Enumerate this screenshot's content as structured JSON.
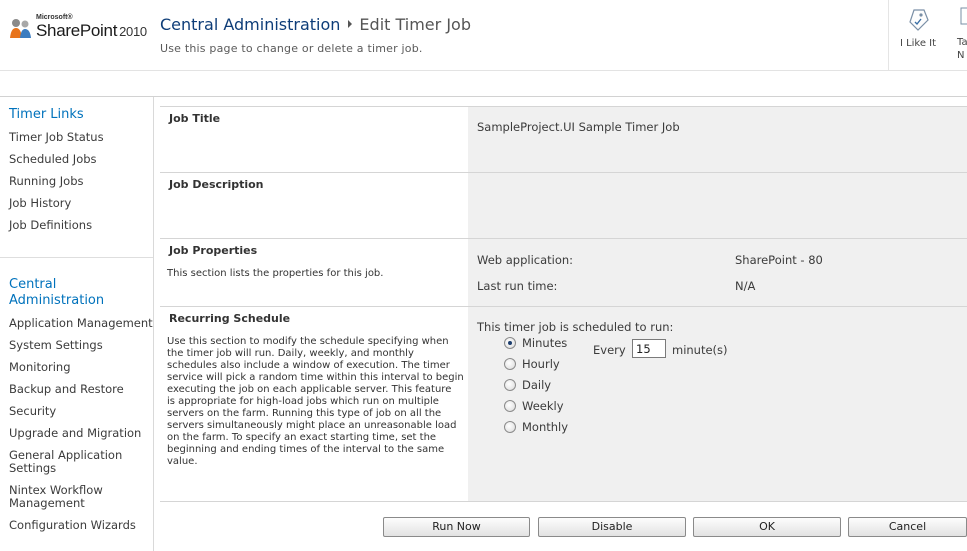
{
  "brand": {
    "microsoft": "Microsoft®",
    "product": "SharePoint",
    "year": "2010"
  },
  "header": {
    "site": "Central Administration",
    "page": "Edit Timer Job",
    "subtitle": "Use this page to change or delete a timer job."
  },
  "social": {
    "like_label": "I Like It",
    "tags_label_line1": "Ta",
    "tags_label_line2": "N"
  },
  "nav": {
    "timer_heading": "Timer Links",
    "timer_items": [
      "Timer Job Status",
      "Scheduled Jobs",
      "Running Jobs",
      "Job History",
      "Job Definitions"
    ],
    "ca_heading_line1": "Central",
    "ca_heading_line2": "Administration",
    "ca_items": [
      "Application Management",
      "System Settings",
      "Monitoring",
      "Backup and Restore",
      "Security",
      "Upgrade and Migration"
    ],
    "general_line1": "General Application",
    "general_line2": "Settings",
    "nintex_line1": "Nintex Workflow",
    "nintex_line2": "Management",
    "config": "Configuration Wizards"
  },
  "form": {
    "job_title": {
      "label": "Job Title",
      "value": "SampleProject.UI Sample Timer Job"
    },
    "job_description": {
      "label": "Job Description"
    },
    "job_properties": {
      "label": "Job Properties",
      "desc": "This section lists the properties for this job.",
      "web_app_label": "Web application:",
      "web_app_value": "SharePoint - 80",
      "last_run_label": "Last run time:",
      "last_run_value": "N/A"
    },
    "recurring": {
      "label": "Recurring Schedule",
      "desc_lines": [
        "Use this section to modify the schedule specifying when",
        "the timer job will run. Daily, weekly, and monthly",
        "schedules also include a window of execution. The timer",
        "service will pick a random time within this interval to begin",
        "executing the job on each applicable server. This feature",
        "is appropriate for high-load jobs which run on multiple",
        "servers on the farm. Running this type of job on all the",
        "servers simultaneously might place an unreasonable load",
        "on the farm. To specify an exact starting time, set the",
        "beginning and ending times of the interval to the same",
        "value."
      ],
      "scheduled_label": "This timer job is scheduled to run:",
      "options": [
        "Minutes",
        "Hourly",
        "Daily",
        "Weekly",
        "Monthly"
      ],
      "selected": "Minutes",
      "every_label": "Every",
      "every_value": "15",
      "every_unit": "minute(s)"
    }
  },
  "buttons": {
    "run_now": "Run Now",
    "disable": "Disable",
    "ok": "OK",
    "cancel": "Cancel"
  },
  "colors": {
    "link_blue": "#0072bc",
    "panel_gray": "#f0f0f0"
  }
}
